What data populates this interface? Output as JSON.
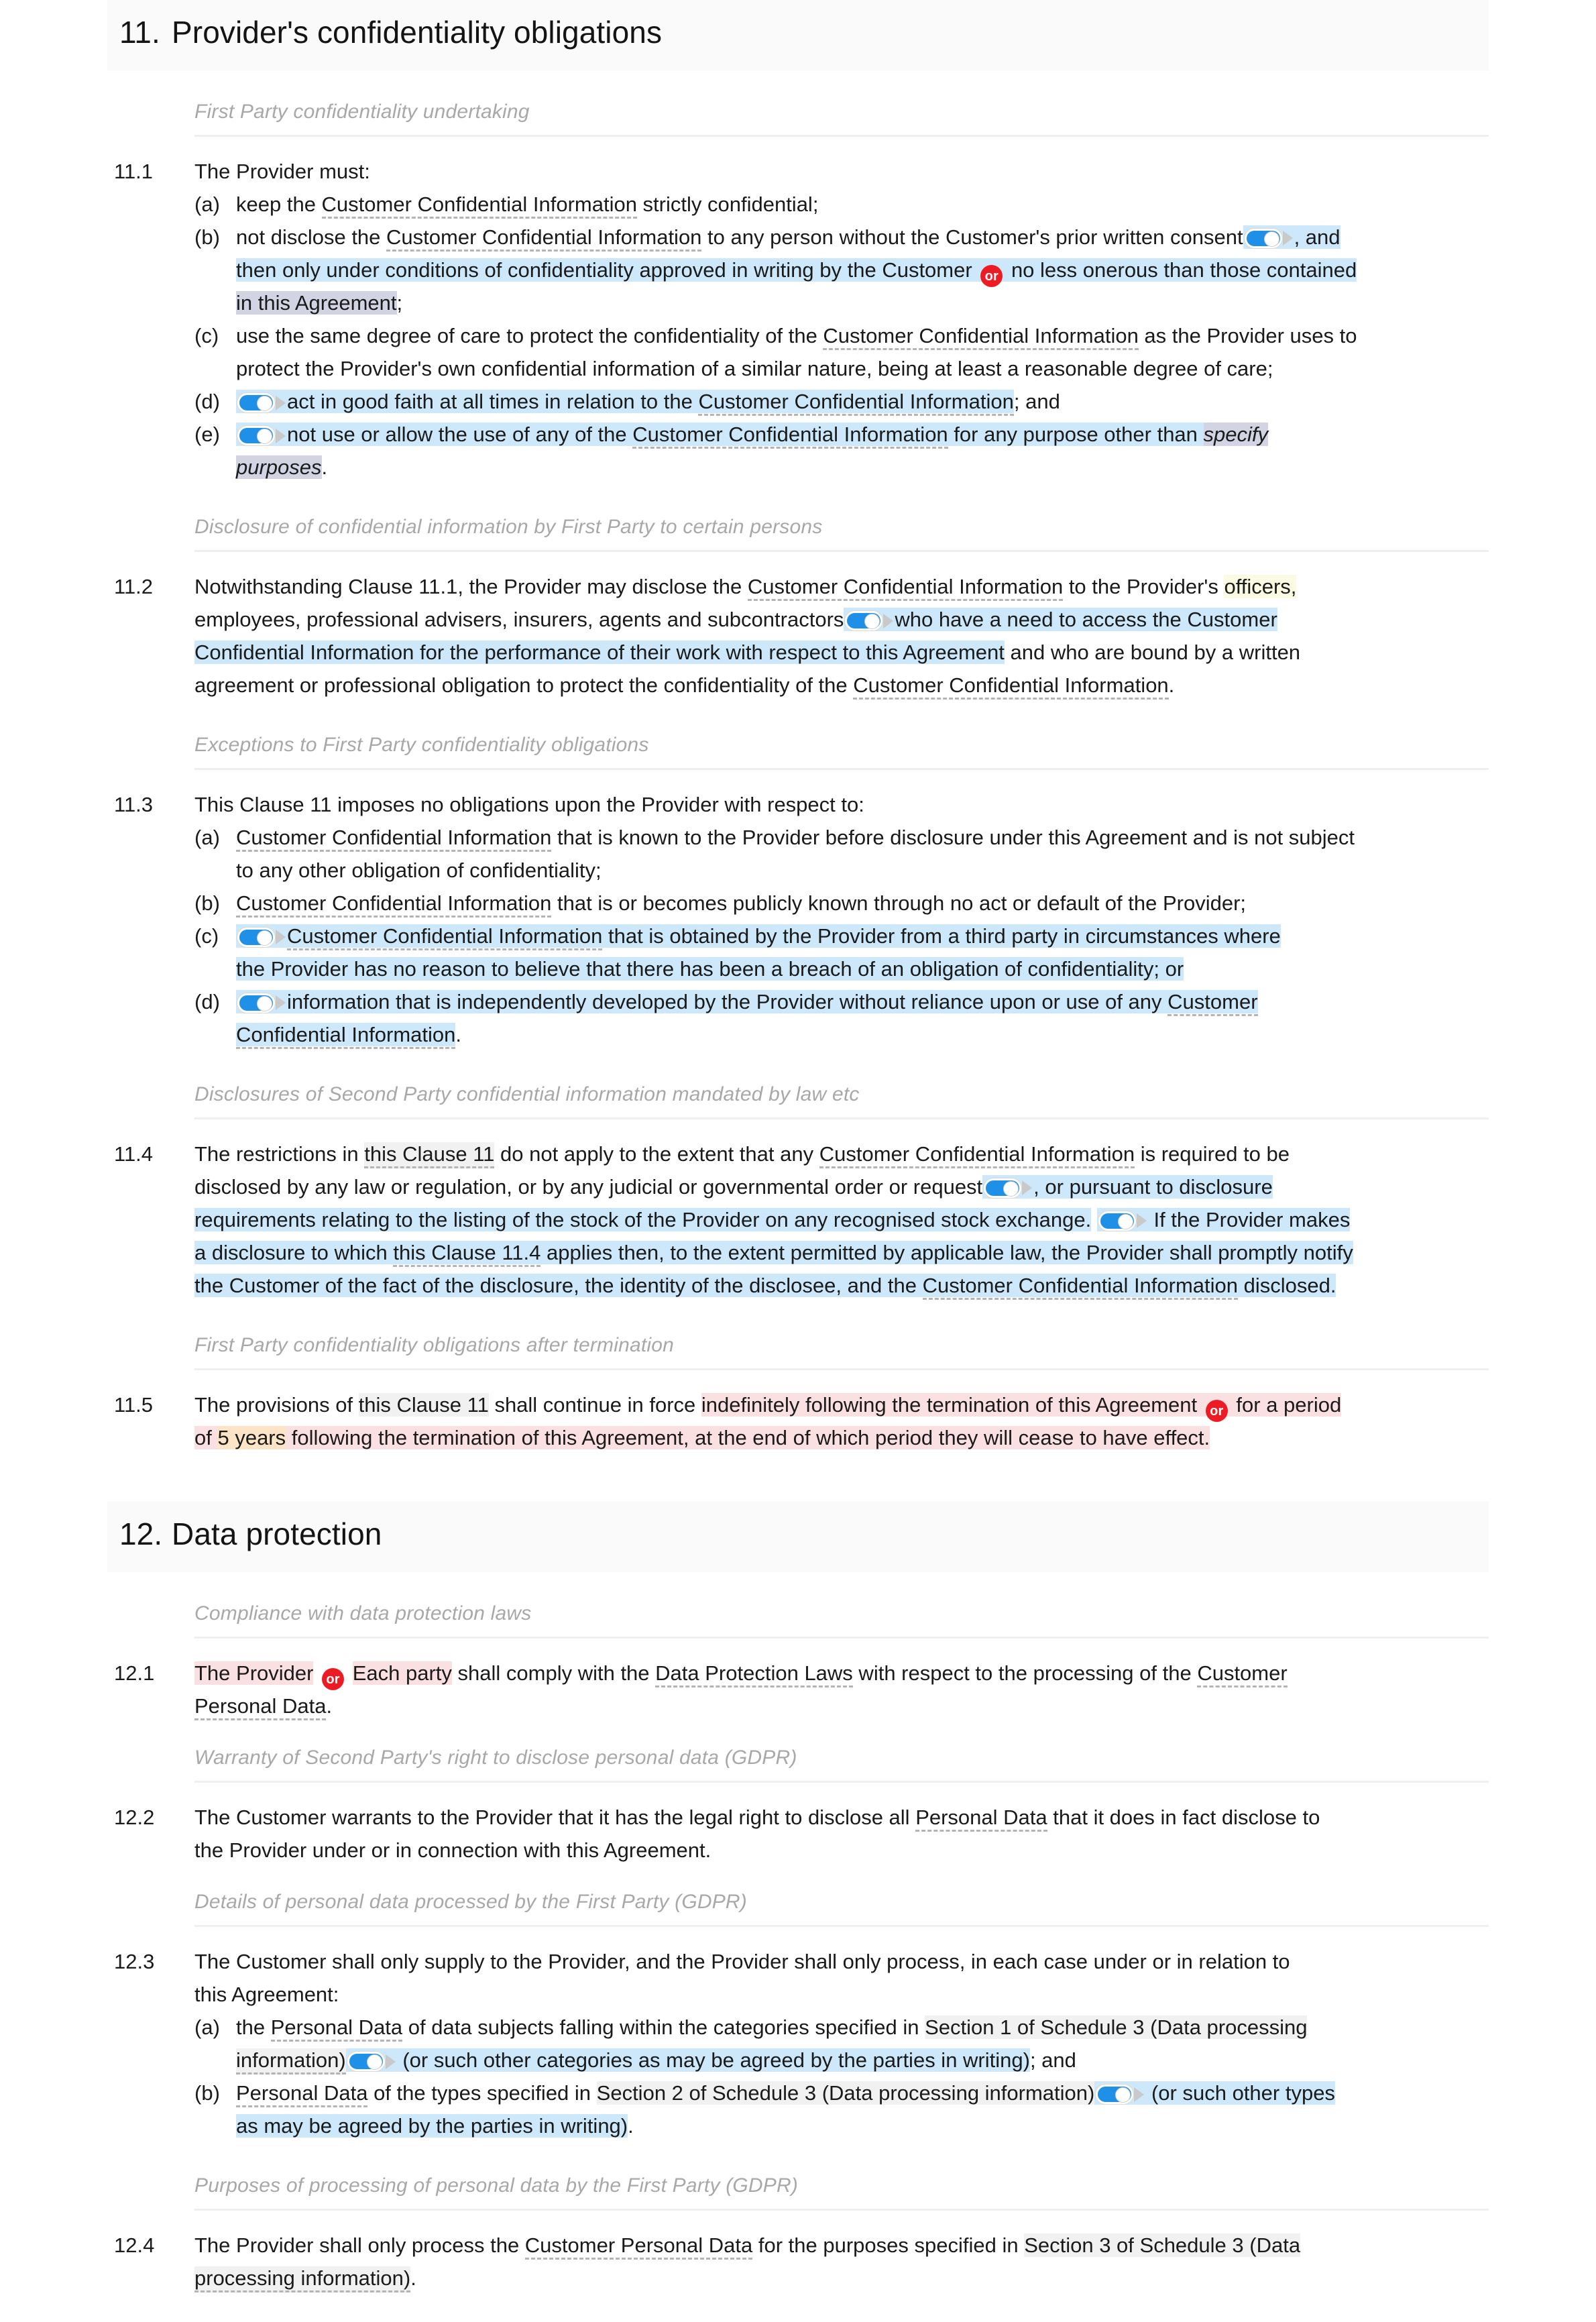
{
  "document": {
    "type": "contract-clause-editor",
    "colors": {
      "highlight_blue": "#cde8fa",
      "highlight_lavender": "#d2d4e4",
      "highlight_yellow": "#fbfbe3",
      "highlight_pink": "#fbe0e1",
      "highlight_peach": "#fde4c6",
      "highlight_grey": "#f1f1f1",
      "toggle_on": "#1e90e8",
      "or_badge": "#ed1c24",
      "section_bar": "#fafafa",
      "subhead_text": "#a8a8a8"
    }
  },
  "sections": [
    {
      "number": "11.",
      "title": "Provider's confidentiality obligations",
      "subheads": {
        "s1": "First Party confidentiality undertaking",
        "s2": "Disclosure of confidential information by First Party to certain persons",
        "s3": "Exceptions to First Party confidentiality obligations",
        "s4": "Disclosures of Second Party confidential information mandated by law etc",
        "s5": "First Party confidentiality obligations after termination"
      }
    },
    {
      "number": "12.",
      "title": "Data protection",
      "subheads": {
        "s1": "Compliance with data protection laws",
        "s2": "Warranty of Second Party's right to disclose personal data (GDPR)",
        "s3": "Details of personal data processed by the First Party (GDPR)",
        "s4": "Purposes of processing of personal data by the First Party (GDPR)"
      }
    }
  ],
  "clauses": {
    "c11_1": {
      "number": "11.1",
      "lead": "The Provider must:",
      "items": {
        "a": {
          "label": "(a)",
          "t1": "keep the ",
          "term1": "Customer Confidential Information",
          "t2": " strictly confidential;"
        },
        "b": {
          "label": "(b)",
          "t1": "not disclose the ",
          "term1": "Customer Confidential Information",
          "t2": " to any person without the Customer's prior written consent",
          "t3": ", and",
          "t4": "then only under conditions of confidentiality approved in writing by the Customer",
          "t5": "no less onerous than those contained",
          "t6": "in this Agreement",
          "t7": ";"
        },
        "c": {
          "label": "(c)",
          "t1": "use the same degree of care to protect the confidentiality of the ",
          "term1": "Customer Confidential Information",
          "t2": " as the Provider uses to",
          "t3": "protect the Provider's own confidential information of a similar nature, being at least a reasonable degree of care;"
        },
        "d": {
          "label": "(d)",
          "t1": "act in good faith at all times in relation to the ",
          "term1": "Customer Confidential Information",
          "t2": "; and"
        },
        "e": {
          "label": "(e)",
          "t1": "not use or allow the use of any of the ",
          "term1": "Customer Confidential Information",
          "t2": " for any purpose other than ",
          "ital1": "specify",
          "ital2": "purposes",
          "t3": "."
        }
      }
    },
    "c11_2": {
      "number": "11.2",
      "t1": "Notwithstanding Clause 11.1, the Provider may disclose the ",
      "term1": "Customer Confidential Information",
      "t2": " to the Provider's ",
      "hl_officers": "officers,",
      "t3": "employees, professional advisers, insurers, agents and subcontractors",
      "t4": "who have a need to access the Customer",
      "t5": "Confidential Information for the performance of their work with respect to this Agreement",
      "t6": " and who are bound by a written",
      "t7": "agreement or professional obligation to protect the confidentiality of the ",
      "term2": "Customer Confidential Information",
      "t8": "."
    },
    "c11_3": {
      "number": "11.3",
      "lead": "This Clause 11 imposes no obligations upon the Provider with respect to:",
      "items": {
        "a": {
          "label": "(a)",
          "term1": "Customer Confidential Information",
          "t1": " that is known to the Provider before disclosure under this Agreement and is not subject",
          "t2": "to any other obligation of confidentiality;"
        },
        "b": {
          "label": "(b)",
          "term1": "Customer Confidential Information",
          "t1": " that is or becomes publicly known through no act or default of the Provider;"
        },
        "c": {
          "label": "(c)",
          "term1": "Customer Confidential Information",
          "t1": " that is obtained by the Provider from a third party in circumstances where",
          "t2": "the Provider has no reason to believe that there has been a breach of an obligation of confidentiality; or"
        },
        "d": {
          "label": "(d)",
          "t1": "information that is independently developed by the Provider without reliance upon or use of any ",
          "term1": "Customer",
          "term2": "Confidential Information",
          "t2": "."
        }
      }
    },
    "c11_4": {
      "number": "11.4",
      "t1": "The restrictions in ",
      "xref1": "this Clause 11",
      "t2": " do not apply to the extent that any ",
      "term1": "Customer Confidential Information",
      "t3": " is required to be",
      "t4": "disclosed by any law or regulation, or by any judicial or governmental order or request",
      "t5": ", or pursuant to disclosure",
      "t6": "requirements relating to the listing of the stock of the Provider on any recognised stock exchange.",
      "t7": "If the Provider makes",
      "t8": "a disclosure to which ",
      "xref2": "this Clause 11.4",
      "t9": " applies then, to the extent permitted by applicable law, the Provider shall promptly notify",
      "t10": "the Customer of the fact of the disclosure, the identity of the disclosee, and the ",
      "term2": "Customer Confidential Information",
      "t11": " disclosed."
    },
    "c11_5": {
      "number": "11.5",
      "t1": "The provisions of ",
      "xref1": "this Clause 11",
      "t2": " shall continue in force ",
      "pink1": "indefinitely following the termination of this Agreement",
      "t3": "for a period",
      "t4": "of ",
      "peach1": "5 years",
      "t5": " following the termination of this Agreement, at the end of which period they will cease to have effect."
    },
    "c12_1": {
      "number": "12.1",
      "pink1": "The Provider",
      "pink2": "Each party",
      "t1": " shall comply with the ",
      "term1": "Data Protection Laws",
      "t2": " with respect to the processing of the ",
      "term2": "Customer",
      "term3": "Personal Data",
      "t3": "."
    },
    "c12_2": {
      "number": "12.2",
      "t1": "The Customer warrants to the Provider that it has the legal right to disclose all ",
      "term1": "Personal Data",
      "t2": " that it does in fact disclose to",
      "t3": "the Provider under or in connection with this Agreement."
    },
    "c12_3": {
      "number": "12.3",
      "lead1": "The Customer shall only supply to the Provider, and the Provider shall only process, in each case under or in relation to",
      "lead2": "this Agreement:",
      "items": {
        "a": {
          "label": "(a)",
          "t1": "the ",
          "term1": "Personal Data",
          "t2": " of data subjects falling within the categories specified in ",
          "xref1": "Section 1 of Schedule 3 (Data processing",
          "xref2": "information)",
          "t3": "(or such other categories as may be agreed by the parties in writing)",
          "t4": "; and"
        },
        "b": {
          "label": "(b)",
          "term1": "Personal Data",
          "t1": " of the types specified in ",
          "xref1": "Section 2 of Schedule 3 (Data processing information)",
          "t2": "(or such other types",
          "t3": "as may be agreed by the parties in writing)",
          "t4": "."
        }
      }
    },
    "c12_4": {
      "number": "12.4",
      "t1": "The Provider shall only process the ",
      "term1": "Customer Personal Data",
      "t2": " for the purposes specified in ",
      "xref1": "Section 3 of Schedule 3 (Data",
      "xref2": "processing information)",
      "t3": "."
    }
  },
  "widgets": {
    "toggle_state": "on",
    "or_label": "or"
  }
}
